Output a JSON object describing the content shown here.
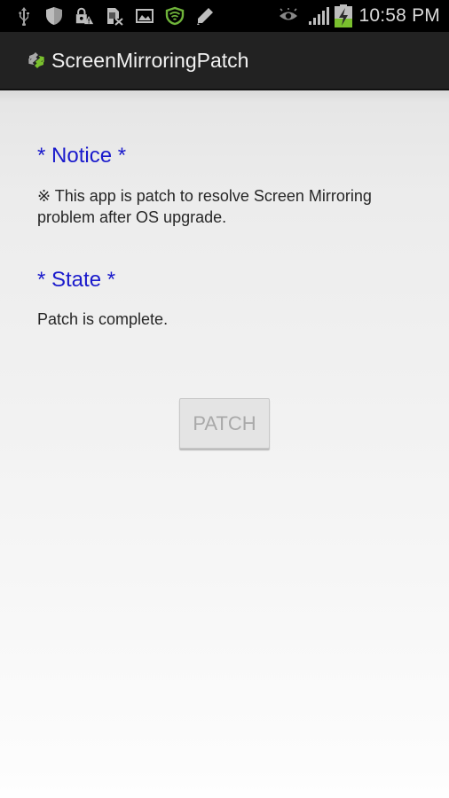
{
  "status_bar": {
    "left_icons": [
      "usb-icon",
      "shield-icon",
      "lock-warning-icon",
      "sim-error-icon",
      "image-icon",
      "security-app-icon",
      "pen-icon"
    ],
    "right_icons": [
      "eye-icon",
      "signal-icon",
      "battery-charging-icon"
    ],
    "time": "10:58 PM",
    "colors": {
      "icon_gray": "#9a9a9a",
      "security_green": "#6fb33a",
      "battery_green": "#7ac02e"
    }
  },
  "action_bar": {
    "title": "ScreenMirroringPatch",
    "icon": "app-swap-arrows-icon"
  },
  "main": {
    "notice": {
      "title": "* Notice *",
      "text": "※ This app is patch to resolve Screen Mirroring problem after OS upgrade."
    },
    "state": {
      "title": "* State *",
      "text": "Patch is complete."
    },
    "patch_button": {
      "label": "PATCH",
      "enabled": false
    },
    "colors": {
      "heading": "#1a1acc",
      "text": "#262626",
      "disabled_text": "#a9a9a9"
    }
  }
}
